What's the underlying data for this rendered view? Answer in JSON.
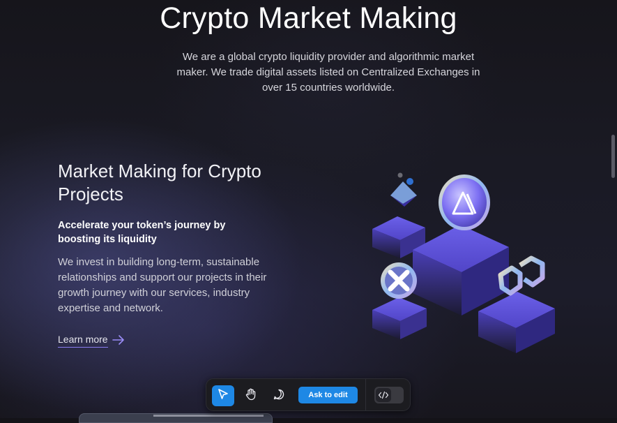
{
  "hero": {
    "title": "Crypto Market Making",
    "subtitle": "We are a global crypto liquidity provider and algorithmic market maker. We trade digital assets listed on Centralized Exchanges in over 15 countries worldwide."
  },
  "section": {
    "title": "Market Making for Crypto Projects",
    "lead": "Accelerate your token’s journey by boosting its liquidity",
    "body": "We invest in building long-term, sustainable relationships and support our projects in their growth journey with our services, industry expertise and network.",
    "cta_label": "Learn more",
    "cta_icon": "arrow-right-icon"
  },
  "toolbar": {
    "tools": [
      "cursor-icon",
      "hand-icon",
      "comment-icon"
    ],
    "active_tool": "cursor-icon",
    "ask_label": "Ask to edit",
    "code_icon": "code-icon"
  },
  "colors": {
    "accent": "#1e88e5",
    "cube": "#5a4fd0",
    "link_underline": "#8a7cf0"
  }
}
